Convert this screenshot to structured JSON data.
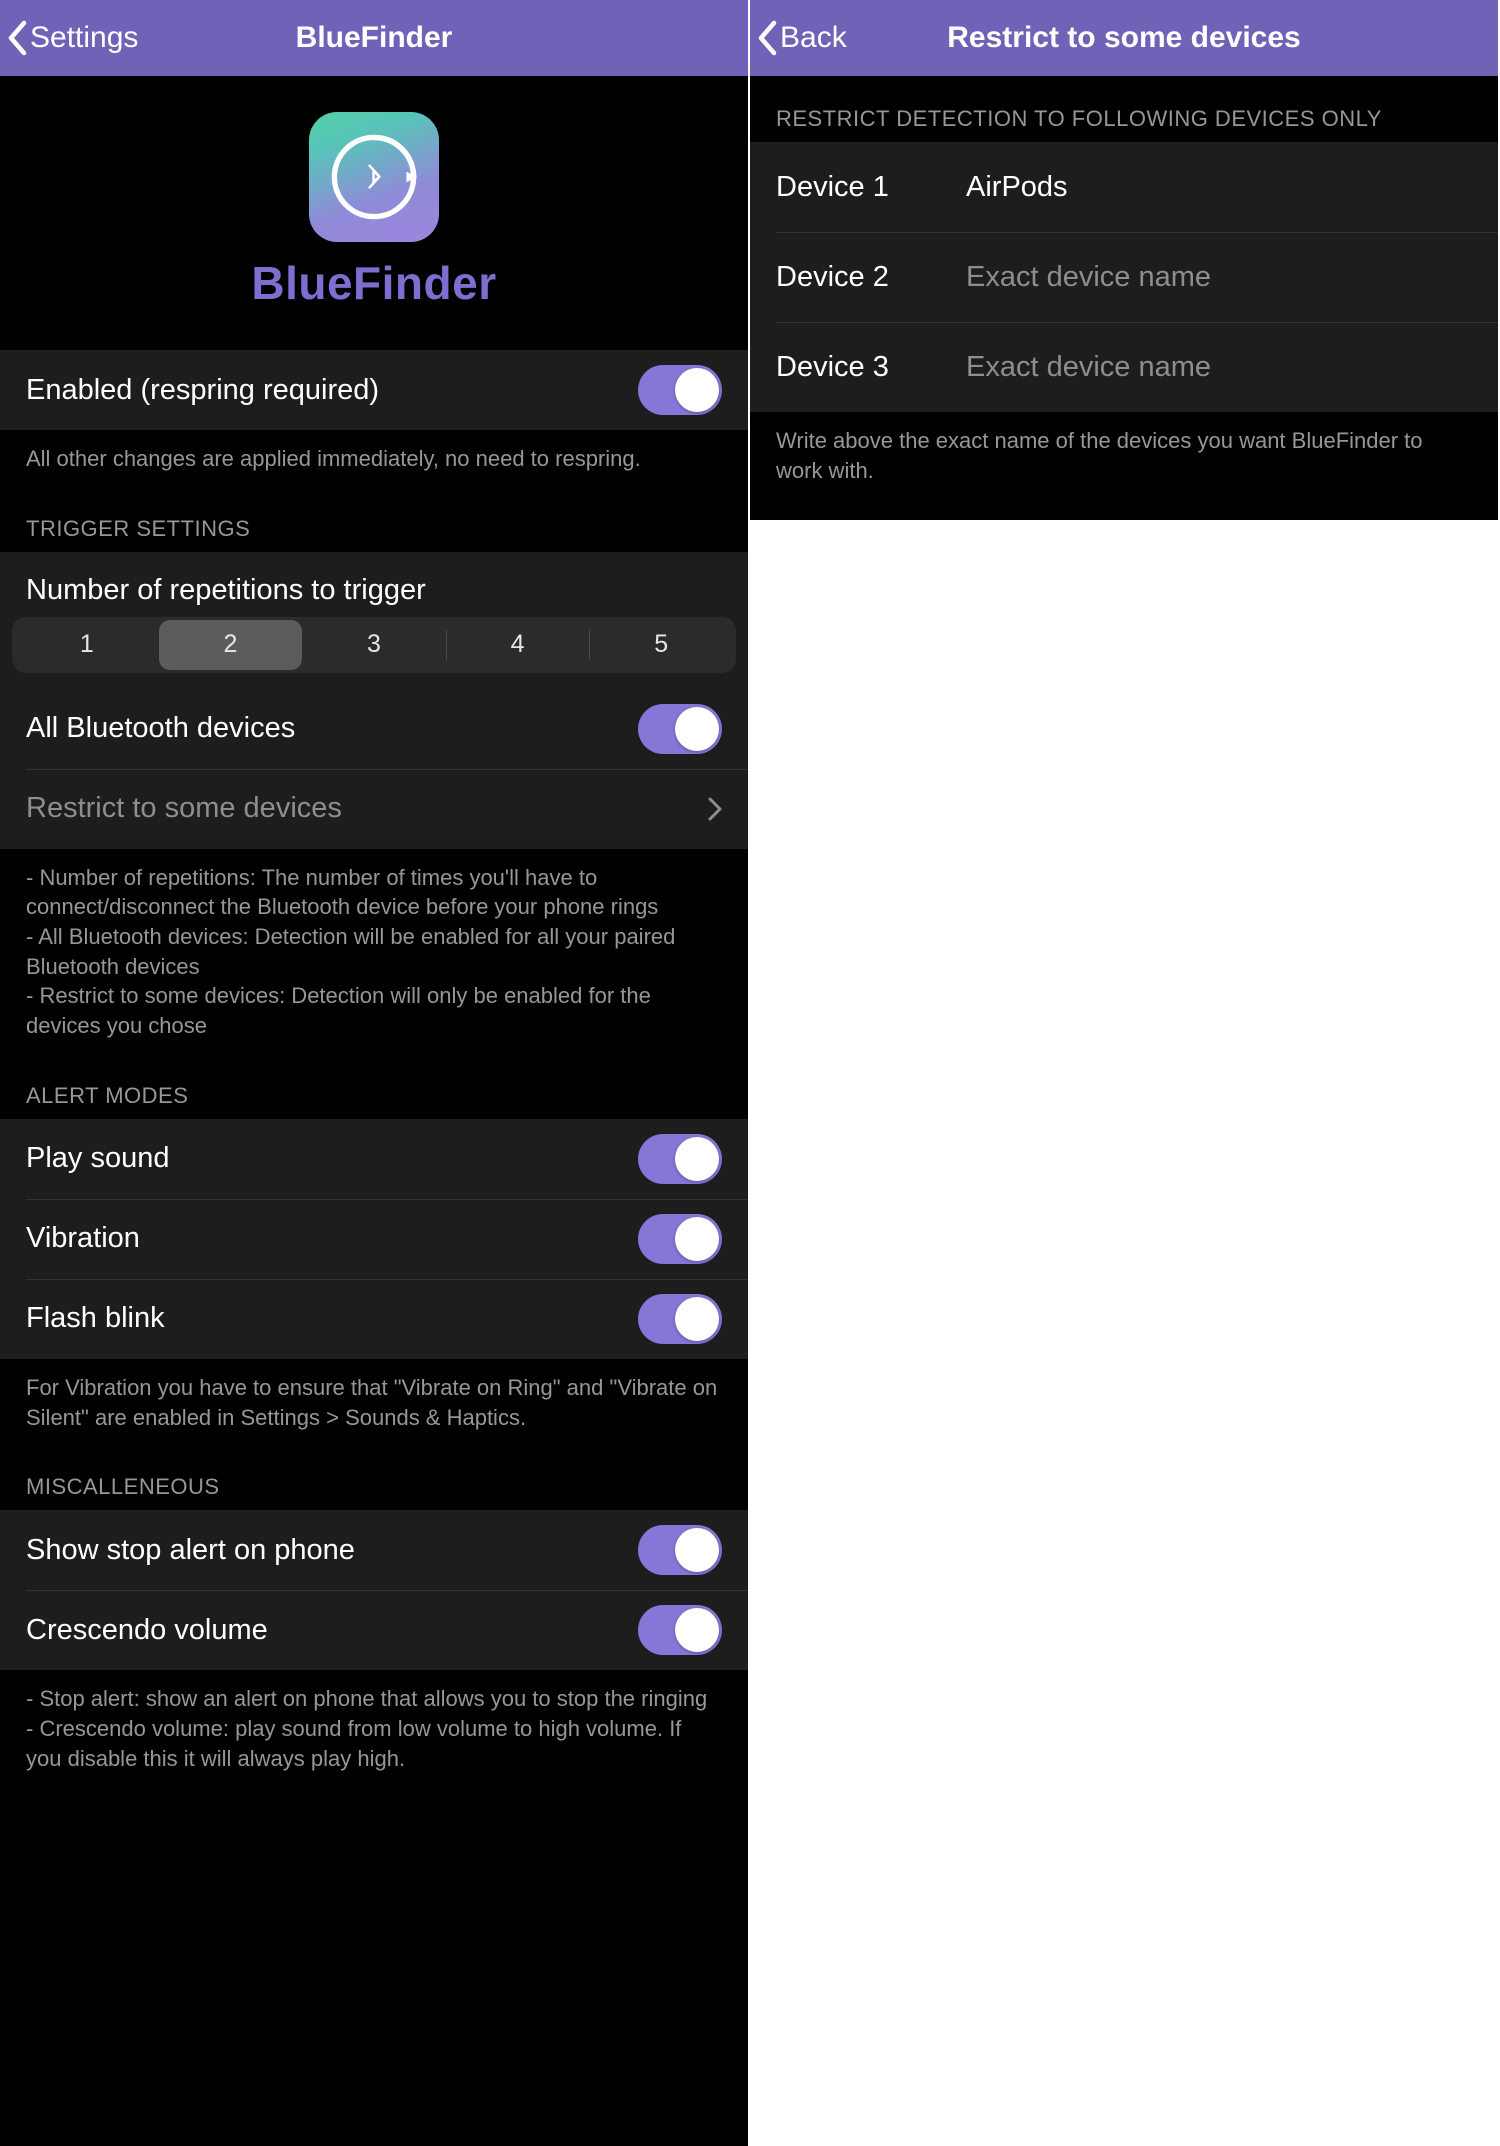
{
  "left": {
    "back_label": "Settings",
    "title": "BlueFinder",
    "logo_text": "BlueFinder",
    "enabled": {
      "label": "Enabled (respring required)",
      "on": true,
      "footer": "All other changes are applied immediately, no need to respring."
    },
    "trigger": {
      "header": "TRIGGER SETTINGS",
      "reps_label": "Number of repetitions to trigger",
      "reps_options": [
        "1",
        "2",
        "3",
        "4",
        "5"
      ],
      "reps_selected": "2",
      "all_devices_label": "All Bluetooth devices",
      "all_devices_on": true,
      "restrict_label": "Restrict to some devices",
      "footer": "- Number of repetitions: The number of times you'll have to connect/disconnect the Bluetooth device before your phone rings\n- All Bluetooth devices: Detection will be enabled for all your paired Bluetooth devices\n- Restrict to some devices: Detection will only be enabled for the devices you chose"
    },
    "alert": {
      "header": "ALERT MODES",
      "play_sound_label": "Play sound",
      "play_sound_on": true,
      "vibration_label": "Vibration",
      "vibration_on": true,
      "flash_label": "Flash blink",
      "flash_on": true,
      "footer": "For Vibration you have to ensure that \"Vibrate on Ring\" and \"Vibrate on Silent\" are enabled in Settings > Sounds & Haptics."
    },
    "misc": {
      "header": "MISCALLENEOUS",
      "stop_alert_label": "Show stop alert on phone",
      "stop_alert_on": true,
      "crescendo_label": "Crescendo volume",
      "crescendo_on": true,
      "footer": "- Stop alert: show an alert on phone that allows you to stop the ringing\n- Crescendo volume: play sound from low volume to high volume. If you disable this it will always play high."
    }
  },
  "right": {
    "back_label": "Back",
    "title": "Restrict to some devices",
    "header": "RESTRICT DETECTION TO FOLLOWING DEVICES ONLY",
    "devices": [
      {
        "key": "Device 1",
        "value": "AirPods",
        "placeholder": "Exact device name"
      },
      {
        "key": "Device 2",
        "value": "",
        "placeholder": "Exact device name"
      },
      {
        "key": "Device 3",
        "value": "",
        "placeholder": "Exact device name"
      }
    ],
    "footer": "Write above the exact name of the devices you want BlueFinder to work with."
  }
}
